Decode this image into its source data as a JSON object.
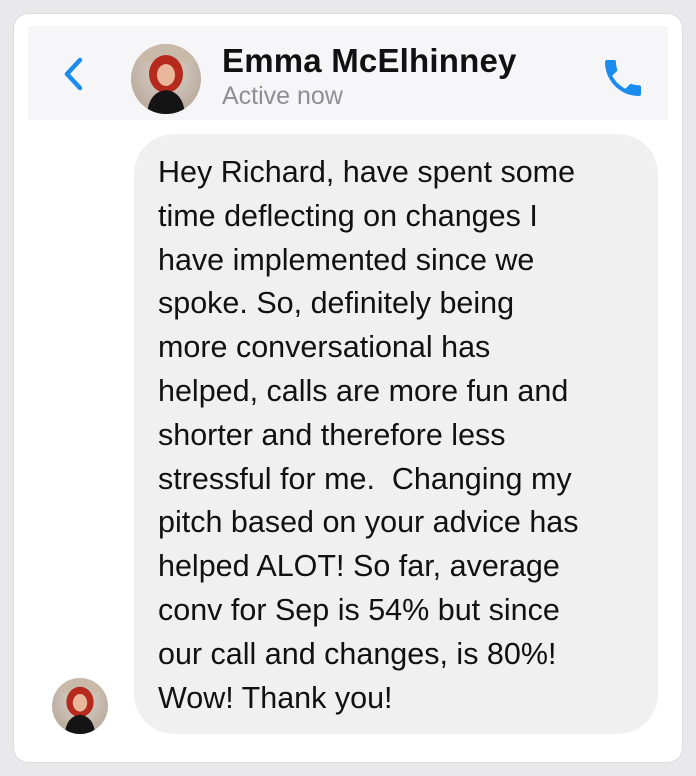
{
  "header": {
    "contact_name": "Emma McElhinney",
    "status": "Active now",
    "icons": {
      "back": "chevron-left-icon",
      "call": "phone-icon"
    },
    "accent_color": "#1a8cf0"
  },
  "message": {
    "lines": [
      "Hey Richard, have spent some",
      "time deflecting on changes I",
      "have implemented since we",
      "spoke. So, definitely being",
      "more conversational has",
      "helped, calls are more fun and",
      "shorter and therefore less",
      "stressful for me.  Changing my",
      "pitch based on your advice has",
      "helped ALOT! So far, average",
      "conv for Sep is 54% but since",
      "our call and changes, is 80%!",
      "Wow! Thank you!"
    ],
    "bubble_color": "#f0f0f1"
  }
}
